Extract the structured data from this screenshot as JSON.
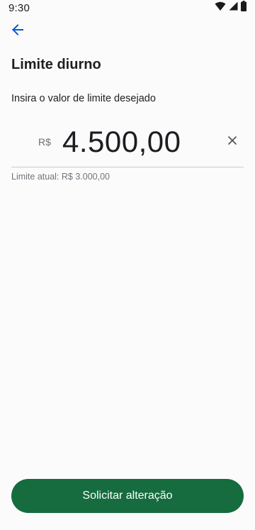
{
  "status_bar": {
    "time": "9:30",
    "icons": [
      "wifi-icon",
      "signal-icon",
      "battery-icon"
    ]
  },
  "header": {
    "back_icon": "arrow-left-icon",
    "title": "Limite diurno"
  },
  "form": {
    "instruction": "Insira o valor de limite desejado",
    "currency_symbol": "R$",
    "amount_value": "4.500,00",
    "clear_icon": "close-icon",
    "current_limit_text": "Limite atual: R$ 3.000,00"
  },
  "actions": {
    "submit_label": "Solicitar alteração"
  },
  "colors": {
    "accent_blue": "#0b57d0",
    "primary_green": "#166b3f",
    "background": "#fbfbfc"
  }
}
